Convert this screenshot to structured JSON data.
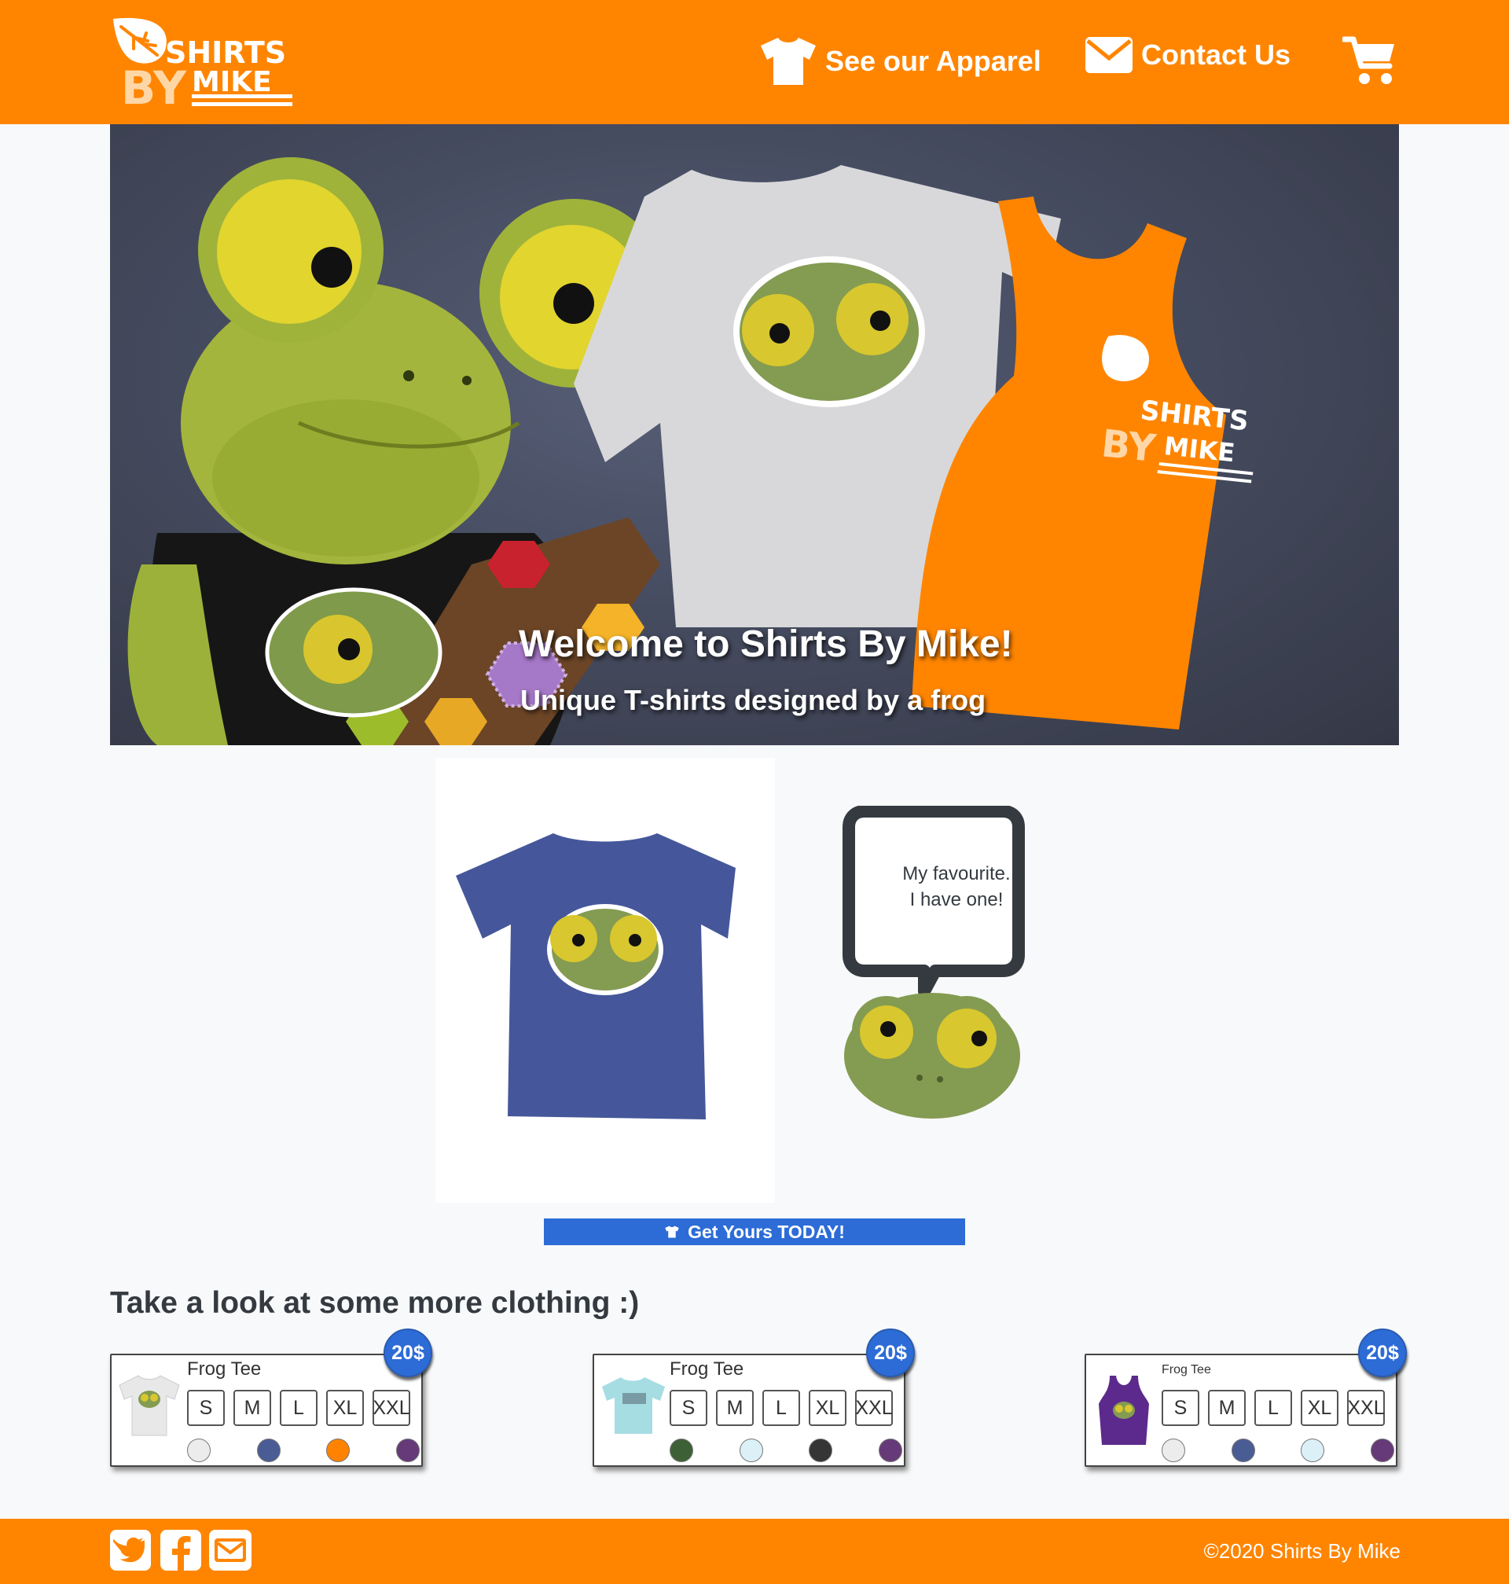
{
  "brand": {
    "logo_line1": "SHIRTS",
    "logo_line2_a": "BY",
    "logo_line2_b": "MIKE"
  },
  "nav": {
    "apparel_label": "See our Apparel",
    "contact_label": "Contact Us"
  },
  "hero": {
    "title": "Welcome to Shirts By Mike!",
    "subtitle": "Unique T-shirts designed by a frog"
  },
  "featured": {
    "speech_line1": "My favourite.",
    "speech_line2": "I have one!",
    "cta_label": "Get Yours TODAY!"
  },
  "more_section": {
    "title": "Take a look at some more clothing :)"
  },
  "products": [
    {
      "name": "Frog Tee",
      "price": "20$",
      "sizes": [
        "S",
        "M",
        "L",
        "XL",
        "XXL"
      ],
      "colors": [
        "#ececec",
        "#4a5c94",
        "#ff8200",
        "#663a78"
      ]
    },
    {
      "name": "Frog Tee",
      "price": "20$",
      "sizes": [
        "S",
        "M",
        "L",
        "XL",
        "XXL"
      ],
      "colors": [
        "#3e6036",
        "#dcf1f7",
        "#353535",
        "#663a78"
      ]
    },
    {
      "name": "Frog Tee",
      "price": "20$",
      "sizes": [
        "S",
        "M",
        "L",
        "XL",
        "XXL"
      ],
      "colors": [
        "#ececec",
        "#4a5c94",
        "#dcf1f7",
        "#663a78"
      ]
    }
  ],
  "footer": {
    "copyright": "©2020 Shirts By Mike",
    "social_icons": [
      "twitter-icon",
      "facebook-icon",
      "envelope-icon"
    ]
  },
  "colors": {
    "brand_orange": "#ff8500",
    "accent_blue": "#2d6cd6",
    "page_bg": "#f8f9fa"
  }
}
